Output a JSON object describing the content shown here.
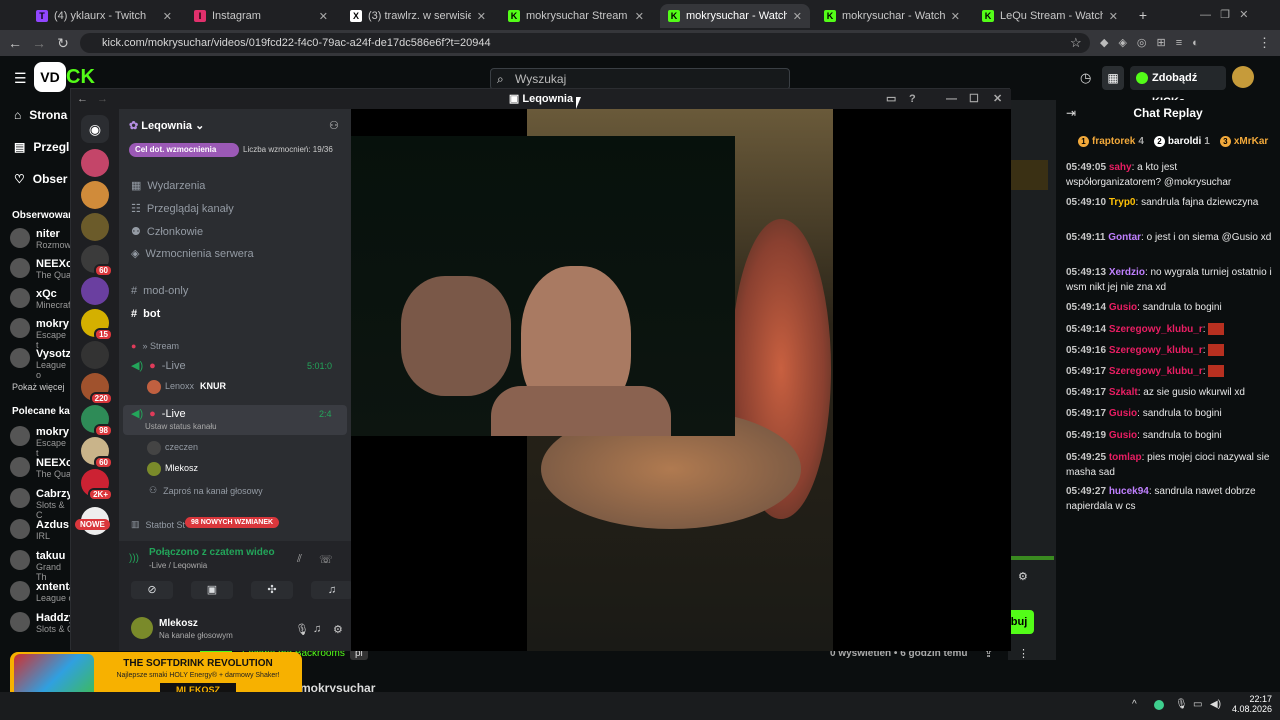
{
  "tabs": [
    {
      "label": "(4) yklaurx - Twitch",
      "color": "#9146ff",
      "glyph": "T"
    },
    {
      "label": "Instagram",
      "color": "#e1306c",
      "glyph": "I"
    },
    {
      "label": "(3) trawlrz. w serwisie X: „2026/",
      "color": "#ffffff",
      "glyph": "X"
    },
    {
      "label": "mokrysuchar Stream - Watch L",
      "color": "#53fc18",
      "glyph": "K"
    },
    {
      "label": "mokrysuchar - Watch the VOD",
      "color": "#53fc18",
      "glyph": "K"
    },
    {
      "label": "mokrysuchar - Watch the VOD",
      "color": "#53fc18",
      "glyph": "K"
    },
    {
      "label": "LeQu Stream - Watch Live on K",
      "color": "#53fc18",
      "glyph": "K"
    }
  ],
  "url": "kick.com/mokrysuchar/videos/019fcd22-f4c0-79ac-a24f-de17dc586e6f?t=20944",
  "kick": {
    "search_placeholder": "Wyszukaj",
    "kicks_button": "Zdobądź KICKs",
    "nav": [
      "Strona",
      "Przegl",
      "Obser"
    ],
    "followed_title": "Obserwowar",
    "followed": [
      {
        "name": "niter",
        "sub": "Rozmow"
      },
      {
        "name": "NEEXc",
        "sub": "The Qua"
      },
      {
        "name": "xQc",
        "sub": "Minecraf"
      },
      {
        "name": "mokry",
        "sub": "Escape t"
      },
      {
        "name": "Vysotz",
        "sub": "League o"
      }
    ],
    "show_more": "Pokaż więcej",
    "recommended_title": "Polecane kan",
    "recommended": [
      {
        "name": "mokry",
        "sub": "Escape t"
      },
      {
        "name": "NEEXc",
        "sub": "The Qua"
      },
      {
        "name": "Cabrzy",
        "sub": "Slots & C"
      },
      {
        "name": "Azdus",
        "sub": "IRL"
      },
      {
        "name": "takuu",
        "sub": "Grand Th"
      },
      {
        "name": "xntenta",
        "sub": "League o"
      },
      {
        "name": "Haddzy",
        "sub": "Slots & C"
      }
    ],
    "follow_button": "buj",
    "stream_category": "Escape the Backrooms",
    "lang": "pl",
    "views": "0 wyświetleń",
    "ago": "6 godzin temu",
    "streamer": "mokrysuchar"
  },
  "chat": {
    "title": "Chat Replay",
    "top": [
      {
        "name": "fraptorek",
        "rank": "1",
        "n": "4",
        "color": "#f2a93b"
      },
      {
        "name": "baroldi",
        "rank": "2",
        "n": "1",
        "color": "#ffffff"
      },
      {
        "name": "xMrKar",
        "rank": "3",
        "n": "",
        "color": "#f2a93b"
      }
    ],
    "messages": [
      {
        "time": "05:49:05",
        "name": "sahy",
        "color": "#e91e63",
        "text": "a kto jest współorganizatorem? @mokrysuchar"
      },
      {
        "time": "05:49:10",
        "name": "Tryp0",
        "color": "#ffc107",
        "text": "sandrula fajna dziewczyna"
      },
      {
        "time": "05:49:11",
        "name": "Gontar",
        "color": "#c080ff",
        "text": "o jest i on siema @Gusio xd"
      },
      {
        "time": "05:49:13",
        "name": "Xerdzio",
        "color": "#c080ff",
        "text": "no wygrala turniej ostatnio i wsm nikt jej nie zna xd"
      },
      {
        "time": "05:49:14",
        "name": "Gusio",
        "color": "#e91e63",
        "text": "sandrula to bogini"
      },
      {
        "time": "05:49:14",
        "name": "Szeregowy_klubu_r",
        "color": "#e91e63",
        "text": ""
      },
      {
        "time": "05:49:16",
        "name": "Szeregowy_klubu_r",
        "color": "#e91e63",
        "text": ""
      },
      {
        "time": "05:49:17",
        "name": "Szeregowy_klubu_r",
        "color": "#e91e63",
        "text": ""
      },
      {
        "time": "05:49:17",
        "name": "Szkalt",
        "color": "#e91e63",
        "text": "az sie gusio wkurwil xd"
      },
      {
        "time": "05:49:17",
        "name": "Gusio",
        "color": "#e91e63",
        "text": "sandrula to bogini"
      },
      {
        "time": "05:49:19",
        "name": "Gusio",
        "color": "#e91e63",
        "text": "sandrula to bogini"
      },
      {
        "time": "05:49:25",
        "name": "tomlap",
        "color": "#e91e63",
        "text": "pies mojej cioci nazywal sie masha sad"
      },
      {
        "time": "05:49:27",
        "name": "hucek94",
        "color": "#c080ff",
        "text": "sandrula nawet dobrze napierdala w cs"
      }
    ]
  },
  "discord": {
    "window_title": "Leqownia",
    "server_name": "Leqownia",
    "boost_goal": "Cel dot. wzmocnienia",
    "boost_count": "Liczba wzmocnień: 19/36",
    "menu": [
      "Wydarzenia",
      "Przeglądaj kanały",
      "Członkowie",
      "Wzmocnienia serwera"
    ],
    "text_channels": [
      "mod-only",
      "bot"
    ],
    "category": "» Stream",
    "voice1": {
      "name": "-Live",
      "timer": "5:01:0",
      "user": "Lenoxx",
      "tag": "KNUR"
    },
    "voice2": {
      "name": "-Live",
      "timer": "2:4",
      "status": "Ustaw status kanału",
      "users": [
        "czeczen",
        "Mlekosz"
      ],
      "invite": "Zaproś na kanał głosowy"
    },
    "statbot": "Statbot St",
    "new_mentions": "98 NOWYCH WZMIANEK",
    "new_label": "NOWE",
    "server_badges": [
      "60",
      "15",
      "220",
      "98",
      "60",
      "2K+"
    ],
    "connected": "Połączono z czatem wideo",
    "connected_sub": "-Live / Leqownia",
    "user_name": "Mlekosz",
    "user_status": "Na kanale głosowym"
  },
  "ad": {
    "headline": "THE SOFTDRINK REVOLUTION",
    "sub": "Najlepsze smaki HOLY Energy® + darmowy Shaker!",
    "code": "MLEKOSZ"
  },
  "taskbar": {
    "time": "22:17",
    "date": "4.08.2026"
  }
}
